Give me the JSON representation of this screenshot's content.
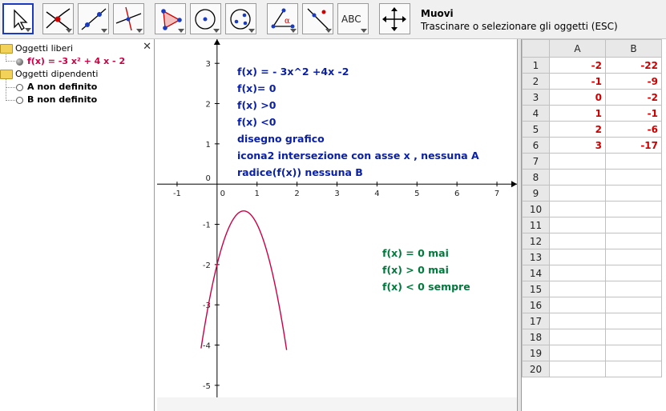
{
  "toolbar": {
    "tools": [
      {
        "name": "move-tool",
        "icon": "pointer-arrow-icon",
        "selected": true
      },
      {
        "name": "point-tool",
        "icon": "intersect-point-icon"
      },
      {
        "name": "line-tool",
        "icon": "line-through-points-icon"
      },
      {
        "name": "perpendicular-tool",
        "icon": "perpendicular-line-icon"
      },
      {
        "name": "polygon-tool",
        "icon": "polygon-icon"
      },
      {
        "name": "circle-tool",
        "icon": "circle-center-point-icon"
      },
      {
        "name": "conic-tool",
        "icon": "conic-ellipse-icon"
      },
      {
        "name": "angle-tool",
        "icon": "angle-icon",
        "symbol": "α"
      },
      {
        "name": "reflect-tool",
        "icon": "reflect-line-icon"
      },
      {
        "name": "text-tool",
        "icon": "text-abc-icon",
        "label": "ABC"
      },
      {
        "name": "move-view-tool",
        "icon": "move-graphics-view-icon"
      }
    ],
    "active_title": "Muovi",
    "active_help": "Trascinare o selezionare gli oggetti (ESC)"
  },
  "algebra": {
    "close_symbol": "✕",
    "free_folder": "Oggetti liberi",
    "function_item": "f(x) = -3 x² + 4 x - 2",
    "dependent_folder": "Oggetti dipendenti",
    "point_a": "A non definito",
    "point_b": "B non definito"
  },
  "graphics": {
    "notes_blue": [
      "f(x) = - 3x^2 +4x -2",
      "f(x)= 0",
      "f(x) >0",
      "f(x) <0",
      "disegno grafico",
      "icona2 intersezione con asse x , nessuna A",
      "radice(f(x)) nessuna B"
    ],
    "notes_green": [
      "f(x) = 0 mai",
      "f(x) > 0 mai",
      "f(x) < 0 sempre"
    ],
    "x_ticks": [
      "-1",
      "0",
      "1",
      "2",
      "3",
      "4",
      "5",
      "6",
      "7"
    ],
    "y_ticks": [
      "3",
      "2",
      "1",
      "0",
      "-1",
      "-2",
      "-3",
      "-4",
      "-5"
    ],
    "colors": {
      "blue_text": "#0a20a8",
      "green_text": "#007a3c",
      "curve": "#cc0044",
      "axes": "#000000"
    }
  },
  "chart_data": {
    "type": "line",
    "series": [
      {
        "name": "f(x) = -3 x² + 4 x - 2",
        "function": "-3*x^2 + 4*x - 2",
        "color": "#cc0044"
      }
    ],
    "xlim": [
      -1.5,
      7.5
    ],
    "ylim": [
      -5.3,
      3.6
    ],
    "grid": false
  },
  "spreadsheet": {
    "columns": [
      "A",
      "B"
    ],
    "rows": [
      {
        "n": "1",
        "a": "-2",
        "b": "-22"
      },
      {
        "n": "2",
        "a": "-1",
        "b": "-9"
      },
      {
        "n": "3",
        "a": "0",
        "b": "-2"
      },
      {
        "n": "4",
        "a": "1",
        "b": "-1"
      },
      {
        "n": "5",
        "a": "2",
        "b": "-6"
      },
      {
        "n": "6",
        "a": "3",
        "b": "-17"
      },
      {
        "n": "7",
        "a": "",
        "b": ""
      },
      {
        "n": "8",
        "a": "",
        "b": ""
      },
      {
        "n": "9",
        "a": "",
        "b": ""
      },
      {
        "n": "10",
        "a": "",
        "b": ""
      },
      {
        "n": "11",
        "a": "",
        "b": ""
      },
      {
        "n": "12",
        "a": "",
        "b": ""
      },
      {
        "n": "13",
        "a": "",
        "b": ""
      },
      {
        "n": "14",
        "a": "",
        "b": ""
      },
      {
        "n": "15",
        "a": "",
        "b": ""
      },
      {
        "n": "16",
        "a": "",
        "b": ""
      },
      {
        "n": "17",
        "a": "",
        "b": ""
      },
      {
        "n": "18",
        "a": "",
        "b": ""
      },
      {
        "n": "19",
        "a": "",
        "b": ""
      },
      {
        "n": "20",
        "a": "",
        "b": ""
      }
    ]
  }
}
